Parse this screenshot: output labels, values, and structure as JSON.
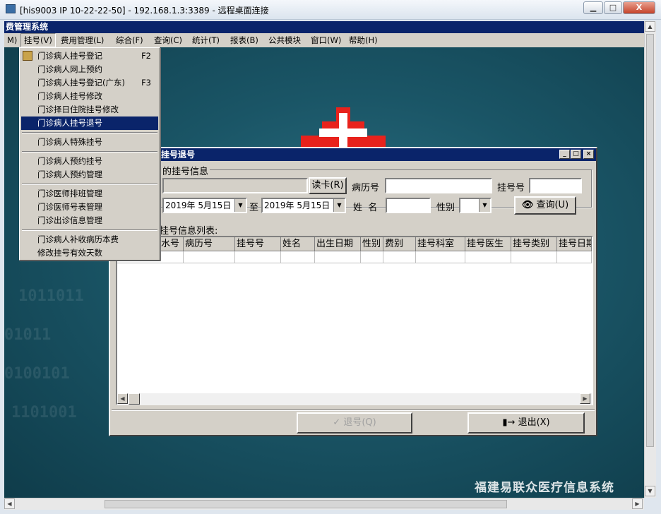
{
  "window": {
    "title": "[his9003  IP 10-22-22-50] - 192.168.1.3:3389 - 远程桌面连接",
    "min": "▁",
    "max": "□",
    "close": "X"
  },
  "app": {
    "title": "费管理系统",
    "brand": "福建易联众医疗信息系统",
    "binary_1": "1011011",
    "binary_2": "01011",
    "binary_3": "0100101",
    "binary_4": "1101001"
  },
  "menu": {
    "items": [
      "M)",
      "挂号(V)",
      "费用管理(L)",
      "综合(F)",
      "查询(C)",
      "统计(T)",
      "报表(B)",
      "公共模块",
      "窗口(W)",
      "帮助(H)"
    ]
  },
  "dropdown": {
    "items": [
      {
        "label": "门诊病人挂号登记",
        "key": "F2"
      },
      {
        "label": "门诊病人网上预约",
        "key": ""
      },
      {
        "label": "门诊病人挂号登记(广东)",
        "key": "F3"
      },
      {
        "label": "门诊病人挂号修改",
        "key": ""
      },
      {
        "label": "门诊择日住院挂号修改",
        "key": ""
      },
      {
        "label": "门诊病人挂号退号",
        "key": ""
      },
      {
        "label": "门诊病人特殊挂号",
        "key": ""
      },
      {
        "label": "门诊病人预约挂号",
        "key": ""
      },
      {
        "label": "门诊病人预约管理",
        "key": ""
      },
      {
        "label": "门诊医师排班管理",
        "key": ""
      },
      {
        "label": "门诊医师号表管理",
        "key": ""
      },
      {
        "label": "门诊出诊信息管理",
        "key": ""
      },
      {
        "label": "门诊病人补收病历本费",
        "key": ""
      },
      {
        "label": "修改挂号有效天数",
        "key": ""
      }
    ],
    "selected_index": 5
  },
  "dialog": {
    "title": "挂号退号",
    "group_label": "的挂号信息",
    "card_button": "读卡(R)",
    "record_label": "病历号",
    "reg_no_label": "挂号号",
    "date_from": "2019年 5月15日",
    "to_label": "至",
    "date_to": "2019年 5月15日",
    "name_label": "姓  名",
    "sex_label": "性别",
    "query_button": "查询(U)",
    "list_label": "挂号信息列表:",
    "columns": [
      "水号",
      "病历号",
      "挂号号",
      "姓名",
      "出生日期",
      "性别",
      "费别",
      "挂号科室",
      "挂号医生",
      "挂号类别",
      "挂号日期"
    ],
    "refund_button": "退号(Q)",
    "exit_button": "退出(X)"
  }
}
